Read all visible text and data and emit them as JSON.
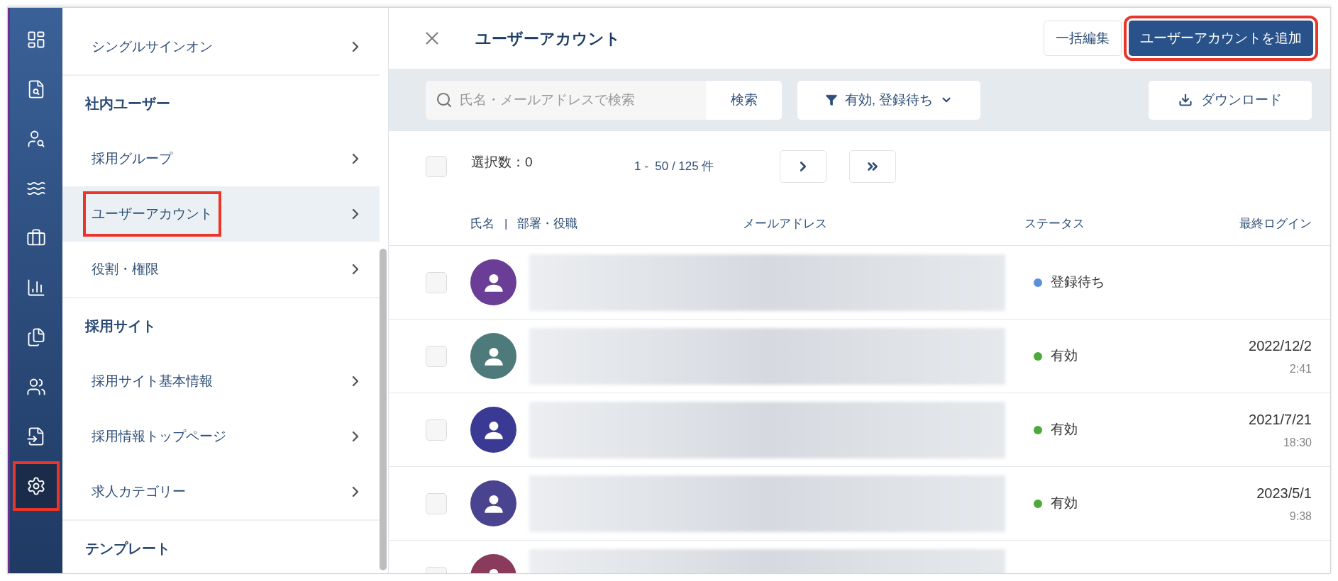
{
  "rail": [
    {
      "kind": "dashboard",
      "selected": false,
      "highlighted": false
    },
    {
      "kind": "document-search",
      "selected": false,
      "highlighted": false
    },
    {
      "kind": "person-search",
      "selected": false,
      "highlighted": false
    },
    {
      "kind": "swimmer",
      "selected": false,
      "highlighted": false
    },
    {
      "kind": "briefcase",
      "selected": false,
      "highlighted": false
    },
    {
      "kind": "bar-chart",
      "selected": false,
      "highlighted": false
    },
    {
      "kind": "documents",
      "selected": false,
      "highlighted": false
    },
    {
      "kind": "people",
      "selected": false,
      "highlighted": false
    },
    {
      "kind": "document-import",
      "selected": false,
      "highlighted": false
    },
    {
      "kind": "settings",
      "selected": true,
      "highlighted": true
    }
  ],
  "sidebar": {
    "sections": [
      {
        "items": [
          {
            "label": "シングルサインオン",
            "selected": false,
            "highlighted": false
          }
        ]
      },
      {
        "heading": "社内ユーザー",
        "items": [
          {
            "label": "採用グループ",
            "selected": false,
            "highlighted": false
          },
          {
            "label": "ユーザーアカウント",
            "selected": true,
            "highlighted": true
          },
          {
            "label": "役割・権限",
            "selected": false,
            "highlighted": false
          }
        ]
      },
      {
        "heading": "採用サイト",
        "items": [
          {
            "label": "採用サイト基本情報",
            "selected": false,
            "highlighted": false
          },
          {
            "label": "採用情報トップページ",
            "selected": false,
            "highlighted": false
          },
          {
            "label": "求人カテゴリー",
            "selected": false,
            "highlighted": false
          }
        ]
      },
      {
        "heading": "テンプレート"
      }
    ]
  },
  "panel": {
    "title": "ユーザーアカウント",
    "bulk_edit_button": "一括編集",
    "add_button": {
      "label": "ユーザーアカウントを追加",
      "highlighted": true
    },
    "search": {
      "placeholder": "氏名・メールアドレスで検索",
      "button": "検索"
    },
    "filter": {
      "label": "有効, 登録待ち"
    },
    "download_button": "ダウンロード",
    "selection": {
      "label": "選択数：0",
      "checked": false
    },
    "pagination": {
      "range": "1 -  50 / 125 件"
    },
    "columns": [
      "氏名",
      "|",
      "部署・役職",
      "メールアドレス",
      "ステータス",
      "最終ログイン"
    ],
    "rows": [
      {
        "checked": false,
        "avatar": {
          "color": "#6a3d96"
        },
        "status": {
          "label": "登録待ち",
          "color": "#5b8fdc"
        }
      },
      {
        "checked": false,
        "avatar": {
          "color": "#4e7a7c"
        },
        "status": {
          "label": "有効",
          "color": "#4caa3a"
        },
        "date": "2022/12/2",
        "time": "2:41"
      },
      {
        "checked": false,
        "avatar": {
          "color": "#3a3a94"
        },
        "status": {
          "label": "有効",
          "color": "#4caa3a"
        },
        "date": "2021/7/21",
        "time": "18:30"
      },
      {
        "checked": false,
        "avatar": {
          "color": "#4a4490"
        },
        "status": {
          "label": "有効",
          "color": "#4caa3a"
        },
        "date": "2023/5/1",
        "time": "9:38"
      },
      {
        "checked": false,
        "avatar": {
          "color": "#8a3a5a"
        }
      }
    ]
  }
}
